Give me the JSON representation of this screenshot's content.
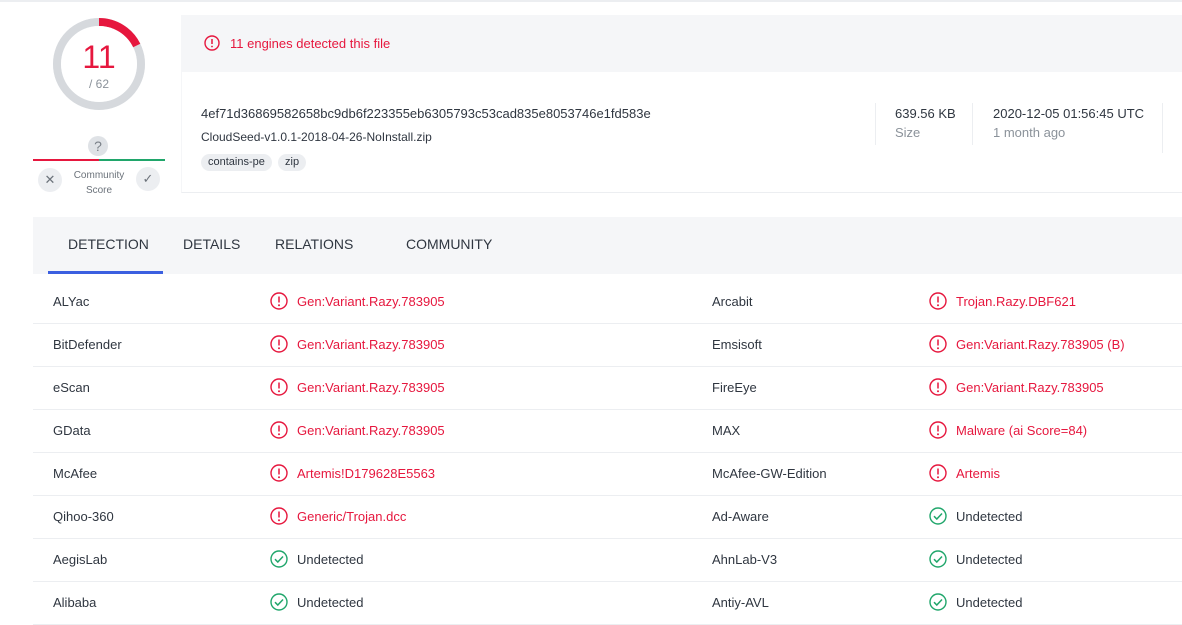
{
  "score": {
    "detected": "11",
    "total": "/ 62",
    "ratio": 0.177,
    "ring_color": "#e6173e"
  },
  "community": {
    "unknown_icon": "?",
    "label_line1": "Community",
    "label_line2": "Score",
    "down_icon": "✕",
    "up_icon": "✓"
  },
  "alert": {
    "icon": "alert-circle-icon",
    "text": "11 engines detected this file"
  },
  "file": {
    "hash": "4ef71d36869582658bc9db6f223355eb6305793c53cad835e8053746e1fd583e",
    "name": "CloudSeed-v1.0.1-2018-04-26-NoInstall.zip",
    "tags": [
      "contains-pe",
      "zip"
    ],
    "size_value": "639.56 KB",
    "size_label": "Size",
    "date_value": "2020-12-05 01:56:45 UTC",
    "date_relative": "1 month ago"
  },
  "tabs": [
    "DETECTION",
    "DETAILS",
    "RELATIONS",
    "COMMUNITY"
  ],
  "colors": {
    "malicious": "#e6173e",
    "clean": "#20a66b",
    "tab_accent": "#3b5fe0"
  },
  "detections": [
    {
      "left": {
        "engine": "ALYac",
        "result": "Gen:Variant.Razy.783905",
        "status": "malicious"
      },
      "right": {
        "engine": "Arcabit",
        "result": "Trojan.Razy.DBF621",
        "status": "malicious"
      }
    },
    {
      "left": {
        "engine": "BitDefender",
        "result": "Gen:Variant.Razy.783905",
        "status": "malicious"
      },
      "right": {
        "engine": "Emsisoft",
        "result": "Gen:Variant.Razy.783905 (B)",
        "status": "malicious"
      }
    },
    {
      "left": {
        "engine": "eScan",
        "result": "Gen:Variant.Razy.783905",
        "status": "malicious"
      },
      "right": {
        "engine": "FireEye",
        "result": "Gen:Variant.Razy.783905",
        "status": "malicious"
      }
    },
    {
      "left": {
        "engine": "GData",
        "result": "Gen:Variant.Razy.783905",
        "status": "malicious"
      },
      "right": {
        "engine": "MAX",
        "result": "Malware (ai Score=84)",
        "status": "malicious"
      }
    },
    {
      "left": {
        "engine": "McAfee",
        "result": "Artemis!D179628E5563",
        "status": "malicious"
      },
      "right": {
        "engine": "McAfee-GW-Edition",
        "result": "Artemis",
        "status": "malicious"
      }
    },
    {
      "left": {
        "engine": "Qihoo-360",
        "result": "Generic/Trojan.dcc",
        "status": "malicious"
      },
      "right": {
        "engine": "Ad-Aware",
        "result": "Undetected",
        "status": "clean"
      }
    },
    {
      "left": {
        "engine": "AegisLab",
        "result": "Undetected",
        "status": "clean"
      },
      "right": {
        "engine": "AhnLab-V3",
        "result": "Undetected",
        "status": "clean"
      }
    },
    {
      "left": {
        "engine": "Alibaba",
        "result": "Undetected",
        "status": "clean"
      },
      "right": {
        "engine": "Antiy-AVL",
        "result": "Undetected",
        "status": "clean"
      }
    }
  ]
}
